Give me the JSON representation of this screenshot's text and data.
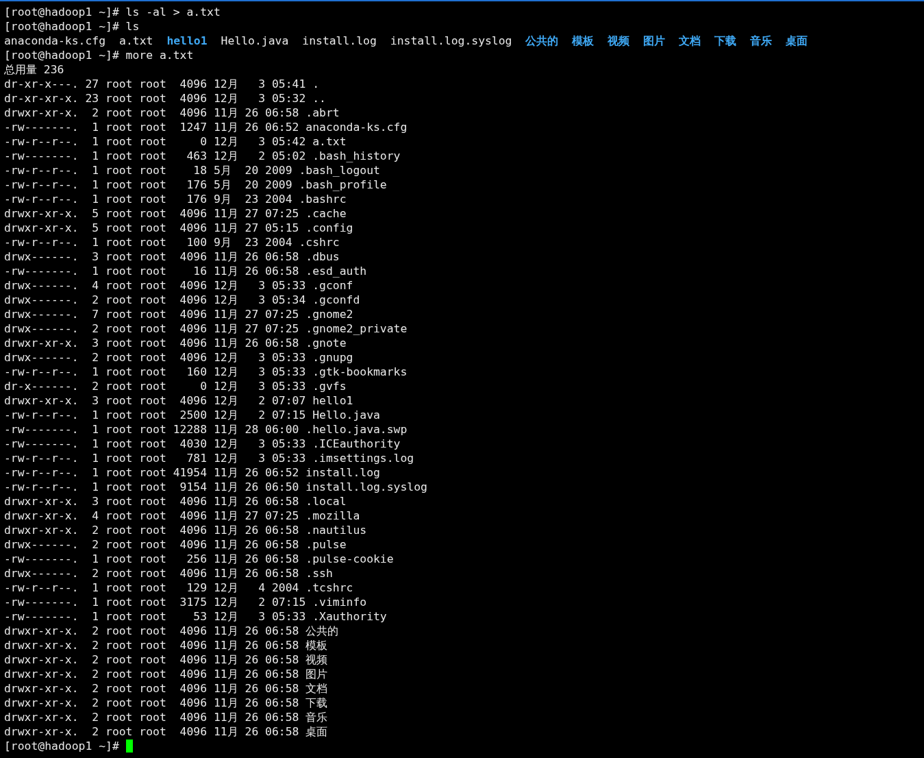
{
  "lines": [
    {
      "kind": "prompt",
      "text": "[root@hadoop1 ~]# ls -al > a.txt",
      "cursor": false
    },
    {
      "kind": "prompt",
      "text": "[root@hadoop1 ~]# ls",
      "cursor": false
    },
    {
      "kind": "ls",
      "entries": [
        {
          "name": "anaconda-ks.cfg",
          "kind": "file"
        },
        {
          "name": "a.txt",
          "kind": "file"
        },
        {
          "name": "hello1",
          "kind": "dir"
        },
        {
          "name": "Hello.java",
          "kind": "file"
        },
        {
          "name": "install.log",
          "kind": "file"
        },
        {
          "name": "install.log.syslog",
          "kind": "file"
        },
        {
          "name": "公共的",
          "kind": "dir"
        },
        {
          "name": "模板",
          "kind": "dir"
        },
        {
          "name": "视频",
          "kind": "dir"
        },
        {
          "name": "图片",
          "kind": "dir"
        },
        {
          "name": "文档",
          "kind": "dir"
        },
        {
          "name": "下载",
          "kind": "dir"
        },
        {
          "name": "音乐",
          "kind": "dir"
        },
        {
          "name": "桌面",
          "kind": "dir"
        }
      ]
    },
    {
      "kind": "prompt",
      "text": "[root@hadoop1 ~]# more a.txt",
      "cursor": false
    },
    {
      "kind": "output",
      "text": "总用量 236"
    },
    {
      "kind": "output",
      "text": "dr-xr-x---. 27 root root  4096 12月   3 05:41 ."
    },
    {
      "kind": "output",
      "text": "dr-xr-xr-x. 23 root root  4096 12月   3 05:32 .."
    },
    {
      "kind": "output",
      "text": "drwxr-xr-x.  2 root root  4096 11月 26 06:58 .abrt"
    },
    {
      "kind": "output",
      "text": "-rw-------.  1 root root  1247 11月 26 06:52 anaconda-ks.cfg"
    },
    {
      "kind": "output",
      "text": "-rw-r--r--.  1 root root     0 12月   3 05:42 a.txt"
    },
    {
      "kind": "output",
      "text": "-rw-------.  1 root root   463 12月   2 05:02 .bash_history"
    },
    {
      "kind": "output",
      "text": "-rw-r--r--.  1 root root    18 5月  20 2009 .bash_logout"
    },
    {
      "kind": "output",
      "text": "-rw-r--r--.  1 root root   176 5月  20 2009 .bash_profile"
    },
    {
      "kind": "output",
      "text": "-rw-r--r--.  1 root root   176 9月  23 2004 .bashrc"
    },
    {
      "kind": "output",
      "text": "drwxr-xr-x.  5 root root  4096 11月 27 07:25 .cache"
    },
    {
      "kind": "output",
      "text": "drwxr-xr-x.  5 root root  4096 11月 27 05:15 .config"
    },
    {
      "kind": "output",
      "text": "-rw-r--r--.  1 root root   100 9月  23 2004 .cshrc"
    },
    {
      "kind": "output",
      "text": "drwx------.  3 root root  4096 11月 26 06:58 .dbus"
    },
    {
      "kind": "output",
      "text": "-rw-------.  1 root root    16 11月 26 06:58 .esd_auth"
    },
    {
      "kind": "output",
      "text": "drwx------.  4 root root  4096 12月   3 05:33 .gconf"
    },
    {
      "kind": "output",
      "text": "drwx------.  2 root root  4096 12月   3 05:34 .gconfd"
    },
    {
      "kind": "output",
      "text": "drwx------.  7 root root  4096 11月 27 07:25 .gnome2"
    },
    {
      "kind": "output",
      "text": "drwx------.  2 root root  4096 11月 27 07:25 .gnome2_private"
    },
    {
      "kind": "output",
      "text": "drwxr-xr-x.  3 root root  4096 11月 26 06:58 .gnote"
    },
    {
      "kind": "output",
      "text": "drwx------.  2 root root  4096 12月   3 05:33 .gnupg"
    },
    {
      "kind": "output",
      "text": "-rw-r--r--.  1 root root   160 12月   3 05:33 .gtk-bookmarks"
    },
    {
      "kind": "output",
      "text": "dr-x------.  2 root root     0 12月   3 05:33 .gvfs"
    },
    {
      "kind": "output",
      "text": "drwxr-xr-x.  3 root root  4096 12月   2 07:07 hello1"
    },
    {
      "kind": "output",
      "text": "-rw-r--r--.  1 root root  2500 12月   2 07:15 Hello.java"
    },
    {
      "kind": "output",
      "text": "-rw-------.  1 root root 12288 11月 28 06:00 .hello.java.swp"
    },
    {
      "kind": "output",
      "text": "-rw-------.  1 root root  4030 12月   3 05:33 .ICEauthority"
    },
    {
      "kind": "output",
      "text": "-rw-r--r--.  1 root root   781 12月   3 05:33 .imsettings.log"
    },
    {
      "kind": "output",
      "text": "-rw-r--r--.  1 root root 41954 11月 26 06:52 install.log"
    },
    {
      "kind": "output",
      "text": "-rw-r--r--.  1 root root  9154 11月 26 06:50 install.log.syslog"
    },
    {
      "kind": "output",
      "text": "drwxr-xr-x.  3 root root  4096 11月 26 06:58 .local"
    },
    {
      "kind": "output",
      "text": "drwxr-xr-x.  4 root root  4096 11月 27 07:25 .mozilla"
    },
    {
      "kind": "output",
      "text": "drwxr-xr-x.  2 root root  4096 11月 26 06:58 .nautilus"
    },
    {
      "kind": "output",
      "text": "drwx------.  2 root root  4096 11月 26 06:58 .pulse"
    },
    {
      "kind": "output",
      "text": "-rw-------.  1 root root   256 11月 26 06:58 .pulse-cookie"
    },
    {
      "kind": "output",
      "text": "drwx------.  2 root root  4096 11月 26 06:58 .ssh"
    },
    {
      "kind": "output",
      "text": "-rw-r--r--.  1 root root   129 12月   4 2004 .tcshrc"
    },
    {
      "kind": "output",
      "text": "-rw-------.  1 root root  3175 12月   2 07:15 .viminfo"
    },
    {
      "kind": "output",
      "text": "-rw-------.  1 root root    53 12月   3 05:33 .Xauthority"
    },
    {
      "kind": "output",
      "text": "drwxr-xr-x.  2 root root  4096 11月 26 06:58 公共的"
    },
    {
      "kind": "output",
      "text": "drwxr-xr-x.  2 root root  4096 11月 26 06:58 模板"
    },
    {
      "kind": "output",
      "text": "drwxr-xr-x.  2 root root  4096 11月 26 06:58 视频"
    },
    {
      "kind": "output",
      "text": "drwxr-xr-x.  2 root root  4096 11月 26 06:58 图片"
    },
    {
      "kind": "output",
      "text": "drwxr-xr-x.  2 root root  4096 11月 26 06:58 文档"
    },
    {
      "kind": "output",
      "text": "drwxr-xr-x.  2 root root  4096 11月 26 06:58 下载"
    },
    {
      "kind": "output",
      "text": "drwxr-xr-x.  2 root root  4096 11月 26 06:58 音乐"
    },
    {
      "kind": "output",
      "text": "drwxr-xr-x.  2 root root  4096 11月 26 06:58 桌面"
    },
    {
      "kind": "prompt",
      "text": "[root@hadoop1 ~]#",
      "cursor": true
    }
  ]
}
